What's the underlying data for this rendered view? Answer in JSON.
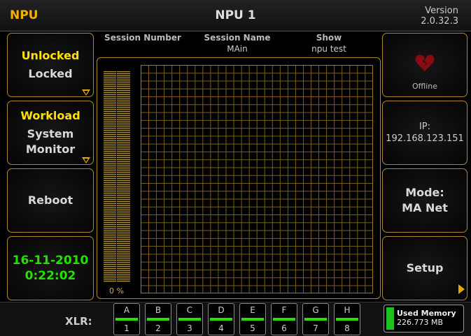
{
  "topbar": {
    "app": "NPU",
    "title": "NPU 1",
    "version_label": "Version",
    "version": "2.0.32.3"
  },
  "lock": {
    "active": "Unlocked",
    "inactive": "Locked"
  },
  "workload": {
    "active": "Workload",
    "line1": "System",
    "line2": "Monitor"
  },
  "reboot": {
    "label": "Reboot"
  },
  "clock": {
    "date": "16-11-2010",
    "time": "0:22:02"
  },
  "session": {
    "number_label": "Session Number",
    "number_value": "",
    "name_label": "Session Name",
    "name_value": "MAin",
    "show_label": "Show",
    "show_value": "npu test"
  },
  "workload_meter": {
    "percent_label": "0 %",
    "value": 0
  },
  "status": {
    "icon": "broken-heart-icon",
    "label": "Offline",
    "color": "#8b0a12"
  },
  "ip": {
    "label": "IP:",
    "value": "192.168.123.151"
  },
  "mode": {
    "label": "Mode:",
    "value": "MA Net"
  },
  "setup": {
    "label": "Setup"
  },
  "xlr": {
    "label": "XLR:",
    "ports": [
      {
        "top": "A",
        "bottom": "1"
      },
      {
        "top": "B",
        "bottom": "2"
      },
      {
        "top": "C",
        "bottom": "3"
      },
      {
        "top": "D",
        "bottom": "4"
      },
      {
        "top": "E",
        "bottom": "5"
      },
      {
        "top": "F",
        "bottom": "6"
      },
      {
        "top": "G",
        "bottom": "7"
      },
      {
        "top": "H",
        "bottom": "8"
      }
    ]
  },
  "memory": {
    "label": "Used Memory",
    "value": "226.773 MB"
  },
  "colors": {
    "accent": "#f0b400",
    "active_text": "#ffe000",
    "clock": "#25e000",
    "border": "#b08a2a"
  }
}
